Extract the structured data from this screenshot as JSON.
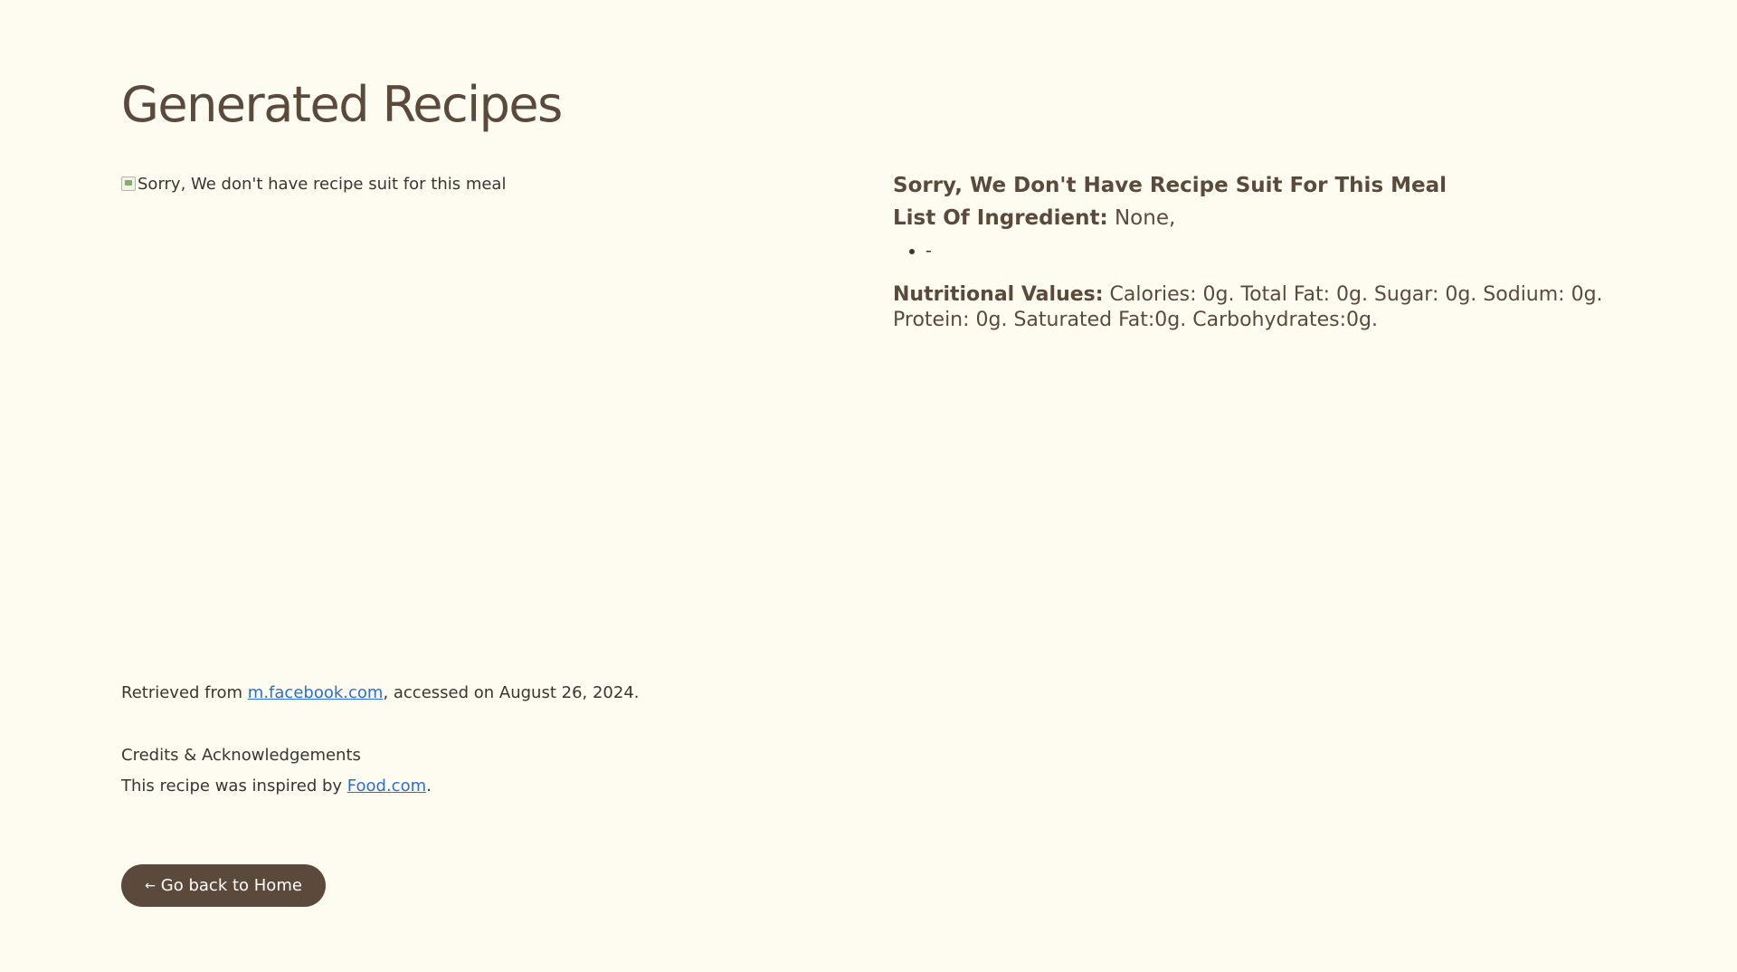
{
  "page": {
    "title": "Generated Recipes"
  },
  "recipe": {
    "image_alt": "Sorry, We don't have recipe suit for this meal",
    "title": "Sorry, We Don't Have Recipe Suit For This Meal",
    "ingredients_label": "List Of Ingredient:",
    "ingredients_value": " None,",
    "ingredient_items": [
      "-"
    ],
    "nutrition_label": "Nutritional Values:",
    "nutrition_value": " Calories: 0g. Total Fat: 0g. Sugar: 0g. Sodium: 0g. Protein: 0g. Saturated Fat:0g. Carbohydrates:0g."
  },
  "source": {
    "prefix": "Retrieved from ",
    "link_text": "m.facebook.com",
    "suffix": ", accessed on August 26, 2024."
  },
  "credits": {
    "heading": "Credits & Acknowledgements",
    "prefix": "This recipe was inspired by ",
    "link_text": "Food.com",
    "suffix": "."
  },
  "actions": {
    "home_arrow": "←",
    "home_label": "Go back to Home"
  },
  "colors": {
    "background": "#fefcf0",
    "primary": "#5b4a3b",
    "link": "#2a6fd6"
  }
}
